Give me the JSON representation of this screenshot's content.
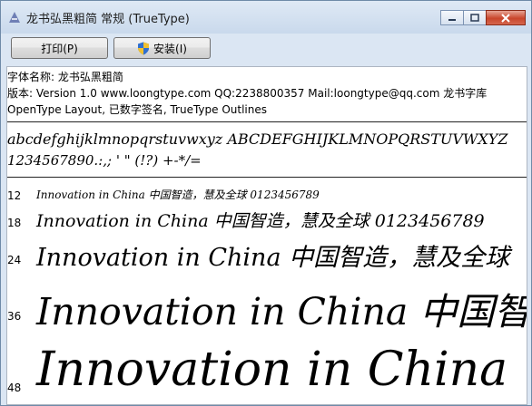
{
  "window": {
    "title": "龙书弘黑粗简 常规 (TrueType)"
  },
  "toolbar": {
    "print_label": "打印(P)",
    "install_label": "安装(I)"
  },
  "font_info": {
    "name_line": "字体名称: 龙书弘黑粗简",
    "version_line": "版本: Version 1.0  www.loongtype.com QQ:2238800357 Mail:loongtype@qq.com 龙书字库",
    "features_line": "OpenType Layout, 已数字签名, TrueType Outlines"
  },
  "charset": {
    "line1": "abcdefghijklmnopqrstuvwxyz ABCDEFGHIJKLMNOPQRSTUVWXYZ",
    "line2": "1234567890.:,; ' \" (!?) +-*/="
  },
  "samples": [
    {
      "size": "12",
      "text": "Innovation in China 中国智造，慧及全球 0123456789"
    },
    {
      "size": "18",
      "text": "Innovation in China 中国智造，慧及全球 0123456789"
    },
    {
      "size": "24",
      "text": "Innovation in China 中国智造，慧及全球"
    },
    {
      "size": "36",
      "text": "Innovation in China 中国智造"
    },
    {
      "size": "48",
      "text": "Innovation in China"
    }
  ],
  "colors": {
    "frame": "#dbe6f3",
    "close": "#c9462c"
  }
}
